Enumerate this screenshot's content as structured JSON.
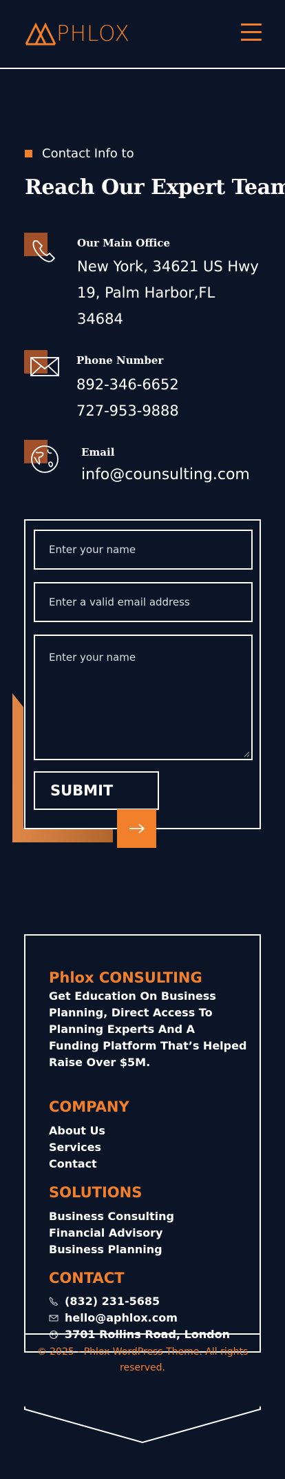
{
  "brand": {
    "name": "PHLOX",
    "accent": "#f17f2c",
    "background": "#0b1527"
  },
  "header": {
    "menu_icon": "hamburger-menu-icon"
  },
  "contact": {
    "eyebrow": "Contact Info to",
    "title": "Reach Our Expert Team",
    "office": {
      "label": "Our Main Office",
      "lines": [
        "New York, 34621 US Hwy",
        "19, Palm Harbor,FL",
        "34684"
      ],
      "icon": "phone-icon"
    },
    "phone": {
      "label": "Phone Number",
      "lines": [
        "892-346-6652",
        "727-953-9888"
      ],
      "icon": "mail-icon"
    },
    "email": {
      "label": "Email",
      "value": "info@counsulting.com",
      "icon": "globe-icon"
    }
  },
  "form": {
    "name_placeholder": "Enter your name",
    "email_placeholder": "Enter a valid email address",
    "message_placeholder": "Enter your name",
    "submit_label": "SUBMIT"
  },
  "footer": {
    "about": {
      "title": "Phlox CONSULTING",
      "text": "Get Education On Business Planning, Direct Access To Planning Experts And A Funding Platform That’s Helped Raise Over $5M."
    },
    "company": {
      "title": "COMPANY",
      "links": [
        "About Us",
        "Services",
        "Contact"
      ]
    },
    "solutions": {
      "title": "SOLUTIONS",
      "links": [
        "Business Consulting",
        "Financial Advisory",
        "Business Planning"
      ]
    },
    "contact": {
      "title": "CONTACT",
      "phone": "(832) 231-5685",
      "email": "hello@aphlox.com",
      "address": "3701 Rollins Road, London"
    },
    "copyright": "© 2025 - Phlox WordPress Theme. All rights reserved."
  }
}
